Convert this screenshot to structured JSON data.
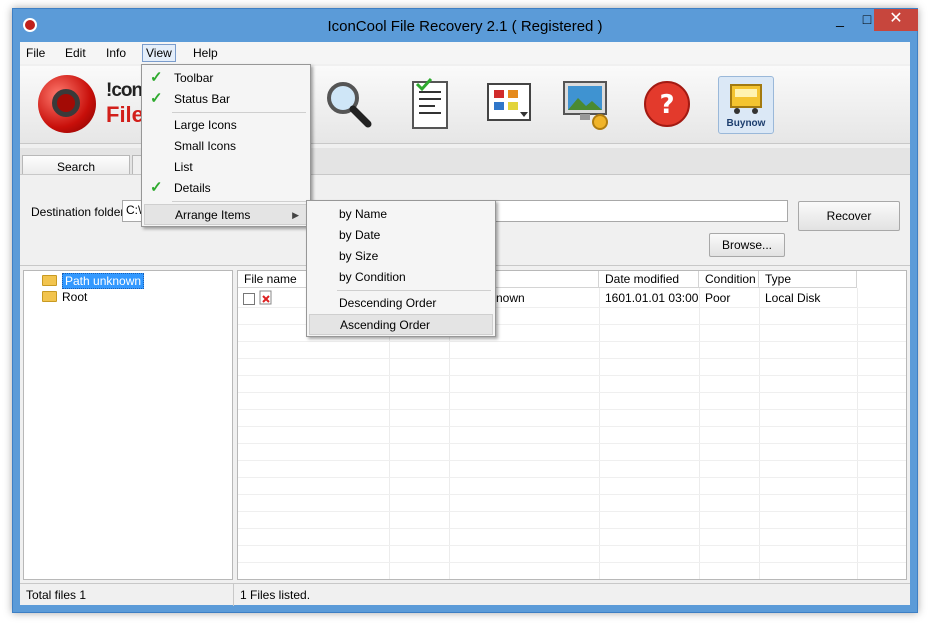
{
  "window": {
    "title": "IconCool File Recovery 2.1 ( Registered )",
    "min": "_",
    "max": "□",
    "close": "✕"
  },
  "menubar": {
    "file": "File",
    "edit": "Edit",
    "info": "Info",
    "view": "View",
    "help": "Help"
  },
  "logo": {
    "line1": "!conc",
    "line2": "File"
  },
  "toolbar": {
    "buynow": "Buynow"
  },
  "tabs": {
    "search": "Search"
  },
  "panel": {
    "dest_label": "Destination folder:",
    "dest_value": "C:\\",
    "recover": "Recover",
    "browse": "Browse..."
  },
  "tree": {
    "items": [
      "Path unknown",
      "Root"
    ]
  },
  "list": {
    "columns": [
      "File name",
      "",
      "",
      "Date modified",
      "Condition",
      "Type"
    ],
    "rows": [
      {
        "name": "",
        "path": "nown",
        "date": "1601.01.01 03:00",
        "condition": "Poor",
        "type": "Local Disk"
      }
    ]
  },
  "status": {
    "left": "Total files 1",
    "right": "1 Files listed."
  },
  "view_menu": {
    "toolbar": "Toolbar",
    "statusbar": "Status Bar",
    "large_icons": "Large Icons",
    "small_icons": "Small Icons",
    "list": "List",
    "details": "Details",
    "arrange": "Arrange Items"
  },
  "arrange_menu": {
    "by_name": "by Name",
    "by_date": "by Date",
    "by_size": "by Size",
    "by_condition": "by Condition",
    "desc": "Descending Order",
    "asc": "Ascending Order"
  },
  "colors": {
    "accent": "#5b9bd8",
    "close": "#c7463d",
    "selection": "#3399ff",
    "check": "#2eaa2e"
  }
}
